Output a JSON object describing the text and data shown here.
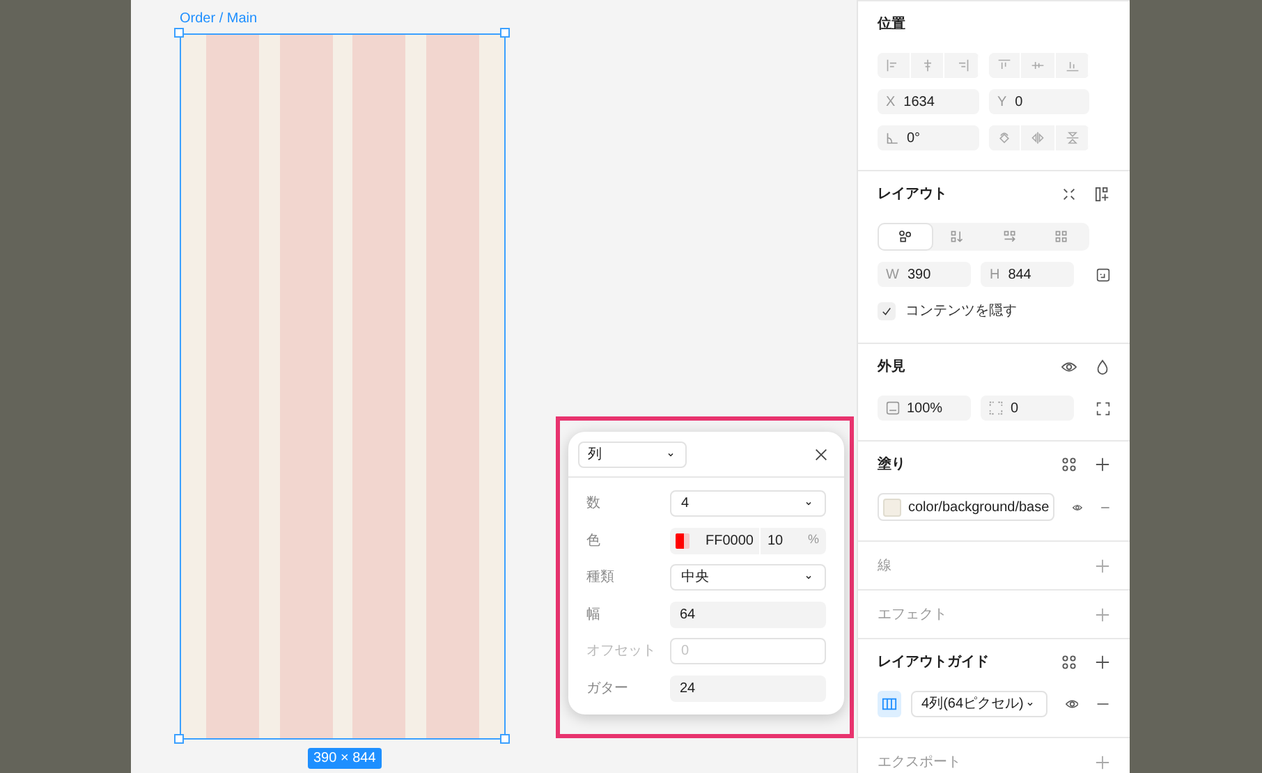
{
  "canvas": {
    "frame_title": "Order / Main",
    "size_label": "390 × 844"
  },
  "grid_popup": {
    "type_select": "列",
    "fields": [
      {
        "kind": "select",
        "label": "数",
        "value": "4",
        "disabled": false
      },
      {
        "kind": "color",
        "label": "色",
        "value": "FF0000",
        "opacity": "10",
        "unit": "%",
        "color": "#ff0000",
        "disabled": false
      },
      {
        "kind": "select",
        "label": "種類",
        "value": "中央",
        "disabled": false
      },
      {
        "kind": "input",
        "label": "幅",
        "value": "64",
        "disabled": false
      },
      {
        "kind": "input",
        "label": "オフセット",
        "placeholder": "0",
        "disabled": true
      },
      {
        "kind": "input",
        "label": "ガター",
        "value": "24",
        "disabled": false
      }
    ]
  },
  "panel": {
    "sections": [
      {
        "kind": "position",
        "title": "位置",
        "empty": false,
        "x": {
          "label": "X",
          "value": "1634"
        },
        "y": {
          "label": "Y",
          "value": "0"
        },
        "rotation": "0°"
      },
      {
        "kind": "layout",
        "title": "レイアウト",
        "empty": false,
        "modes": [
          {
            "selected": true
          },
          {
            "selected": false
          },
          {
            "selected": false
          },
          {
            "selected": false
          }
        ],
        "w": {
          "label": "W",
          "value": "390"
        },
        "h": {
          "label": "H",
          "value": "844"
        },
        "clip": {
          "label": "コンテンツを隠す",
          "checked": true
        }
      },
      {
        "kind": "appearance",
        "title": "外見",
        "empty": false,
        "opacity": "100%",
        "radius": "0"
      },
      {
        "kind": "fill",
        "title": "塗り",
        "empty": false,
        "items": [
          {
            "name": "color/background/base",
            "color": "#f3eee4"
          }
        ]
      },
      {
        "kind": "plain",
        "title": "線",
        "empty": true
      },
      {
        "kind": "plain",
        "title": "エフェクト",
        "empty": true
      },
      {
        "kind": "guide",
        "title": "レイアウトガイド",
        "empty": false,
        "items": [
          {
            "label": "4列(64ピクセル)"
          }
        ]
      },
      {
        "kind": "plain",
        "title": "エクスポート",
        "empty": true
      }
    ]
  }
}
